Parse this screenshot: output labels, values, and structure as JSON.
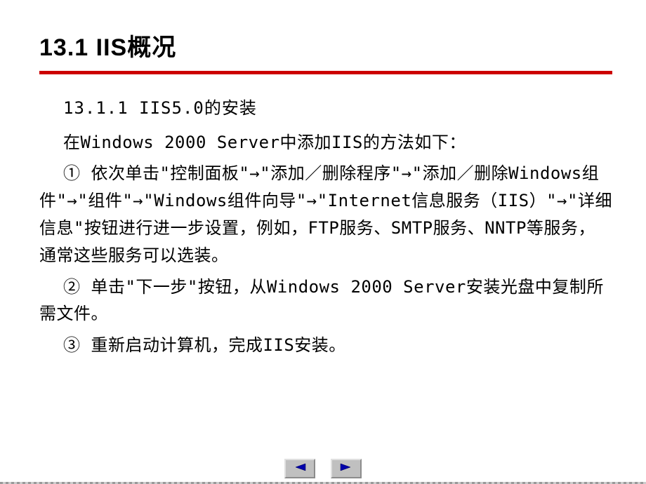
{
  "title": "13.1  IIS概况",
  "subtitle": "13.1.1  IIS5.0的安装",
  "intro": "在Windows 2000 Server中添加IIS的方法如下：",
  "step1": "① 依次单击\"控制面板\"→\"添加／删除程序\"→\"添加／删除Windows组件\"→\"组件\"→\"Windows组件向导\"→\"Internet信息服务（IIS）\"→\"详细信息\"按钮进行进一步设置，例如，FTP服务、SMTP服务、NNTP等服务，通常这些服务可以选装。",
  "step2": "② 单击\"下一步\"按钮，从Windows 2000 Server安装光盘中复制所需文件。",
  "step3": "③ 重新启动计算机，完成IIS安装。",
  "nav": {
    "prev_icon": "triangle-left",
    "next_icon": "triangle-right"
  },
  "colors": {
    "accent": "#cc0000",
    "button_bg": "#c0c0c0"
  }
}
